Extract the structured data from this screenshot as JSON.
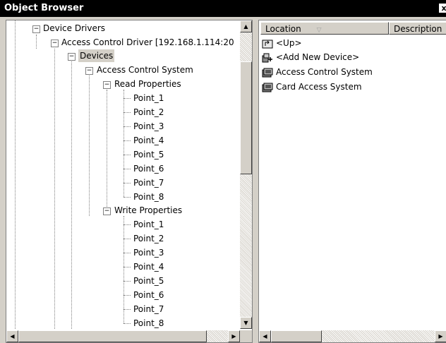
{
  "window": {
    "title": "Object Browser",
    "close_glyph": "x"
  },
  "tree": {
    "items": [
      {
        "label": "Device Drivers"
      },
      {
        "label": "Access Control Driver [192.168.1.114:20"
      },
      {
        "label": "Devices"
      },
      {
        "label": "Access Control System"
      },
      {
        "label": "Read Properties"
      },
      {
        "label": "Point_1"
      },
      {
        "label": "Point_2"
      },
      {
        "label": "Point_3"
      },
      {
        "label": "Point_4"
      },
      {
        "label": "Point_5"
      },
      {
        "label": "Point_6"
      },
      {
        "label": "Point_7"
      },
      {
        "label": "Point_8"
      },
      {
        "label": "Write Properties"
      },
      {
        "label": "Point_1"
      },
      {
        "label": "Point_2"
      },
      {
        "label": "Point_3"
      },
      {
        "label": "Point_4"
      },
      {
        "label": "Point_5"
      },
      {
        "label": "Point_6"
      },
      {
        "label": "Point_7"
      },
      {
        "label": "Point_8"
      }
    ]
  },
  "list": {
    "columns": {
      "location": "Location",
      "description": "Description"
    },
    "items": [
      {
        "label": "<Up>",
        "icon": "up-folder-icon"
      },
      {
        "label": "<Add New Device>",
        "icon": "add-device-icon"
      },
      {
        "label": "Access Control System",
        "icon": "device-icon"
      },
      {
        "label": "Card Access System",
        "icon": "device-icon"
      }
    ]
  },
  "colors": {
    "titlebar": "#000000",
    "selection": "#d4d0c8",
    "window": "#d4d0c8"
  }
}
